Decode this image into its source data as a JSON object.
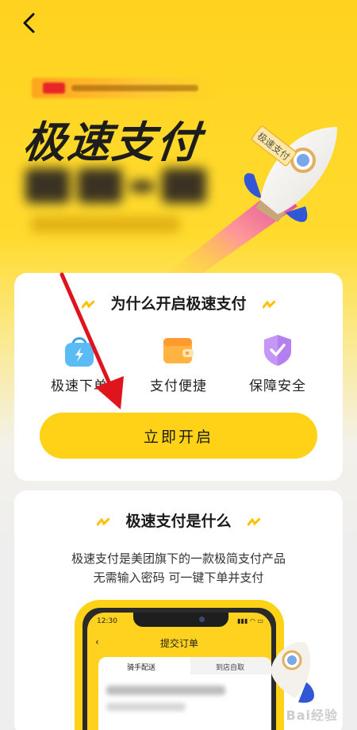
{
  "nav": {
    "back_icon": "chevron-left-icon"
  },
  "hero": {
    "title": "极速支付",
    "rocket_label": "极速支付",
    "blurred_tag_color": "#e8262a"
  },
  "why_card": {
    "title": "为什么开启极速支付",
    "features": [
      {
        "icon": "shopping-bag-lightning-icon",
        "label": "极速下单"
      },
      {
        "icon": "wallet-icon",
        "label": "支付便捷"
      },
      {
        "icon": "shield-check-icon",
        "label": "保障安全"
      }
    ],
    "button_label": "立即开启"
  },
  "what_card": {
    "title": "极速支付是什么",
    "desc_line1": "极速支付是美团旗下的一款极简支付产品",
    "desc_line2": "无需输入密码  可一键下单并支付",
    "phone": {
      "time": "12:30",
      "screen_title": "提交订单",
      "tab_active": "骑手配送",
      "tab_inactive": "到店自取"
    }
  },
  "watermark": "Bai经验",
  "colors": {
    "brand_yellow": "#ffd218",
    "annotation_red": "#e0141c",
    "feature_blue": "#4fb3f2",
    "feature_orange": "#ff9a2e",
    "feature_purple": "#b57ff0"
  }
}
